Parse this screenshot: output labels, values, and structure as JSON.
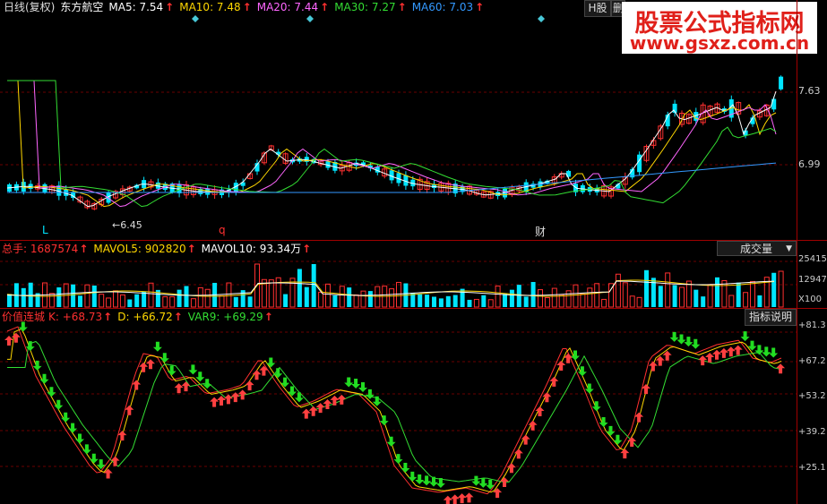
{
  "price_panel": {
    "period_label": "日线(复权)",
    "stock_name": "东方航空",
    "ma": [
      {
        "label": "MA5: 7.54",
        "color": "#ffffff"
      },
      {
        "label": "MA10: 7.48",
        "color": "#ffd700"
      },
      {
        "label": "MA20: 7.44",
        "color": "#ff66ff"
      },
      {
        "label": "MA30: 7.27",
        "color": "#33dd33"
      },
      {
        "label": "MA60: 7.03",
        "color": "#3399ff"
      }
    ],
    "tab_label": "H股",
    "tab_label2": "删",
    "ticks": [
      "7.63",
      "6.99"
    ],
    "low_annotation": "6.45",
    "markers": [
      "L",
      "q",
      "财"
    ]
  },
  "watermark": {
    "line1": "股票公式指标网",
    "line2": "www.gsxz.com.cn"
  },
  "volume_panel": {
    "title": "总手: 1687574",
    "mavol5": "MAVOL5: 902820",
    "mavol10": "MAVOL10: 93.34万",
    "dropdown_label": "成交量",
    "ticks": [
      "25415",
      "12947",
      "X100"
    ]
  },
  "indicator_panel": {
    "title": "价值连城",
    "k": "K: +68.73",
    "d": "D: +66.72",
    "var9": "VAR9: +69.29",
    "help_button": "指标说明",
    "ticks": [
      "+81.3",
      "+67.2",
      "+53.2",
      "+39.2",
      "+25.1"
    ]
  },
  "colors": {
    "up": "#ff3030",
    "down": "#00e5ff",
    "grid": "#a00000",
    "k": "#ff3030",
    "d": "#ff3030",
    "var9": "#33dd33"
  },
  "chart_data": {
    "type": "candlestick",
    "price_range_labels": [
      "7.63",
      "6.99"
    ],
    "low_label": "6.45",
    "indicator_scale": [
      "+81.3",
      "+67.2",
      "+53.2",
      "+39.2",
      "+25.1"
    ]
  }
}
